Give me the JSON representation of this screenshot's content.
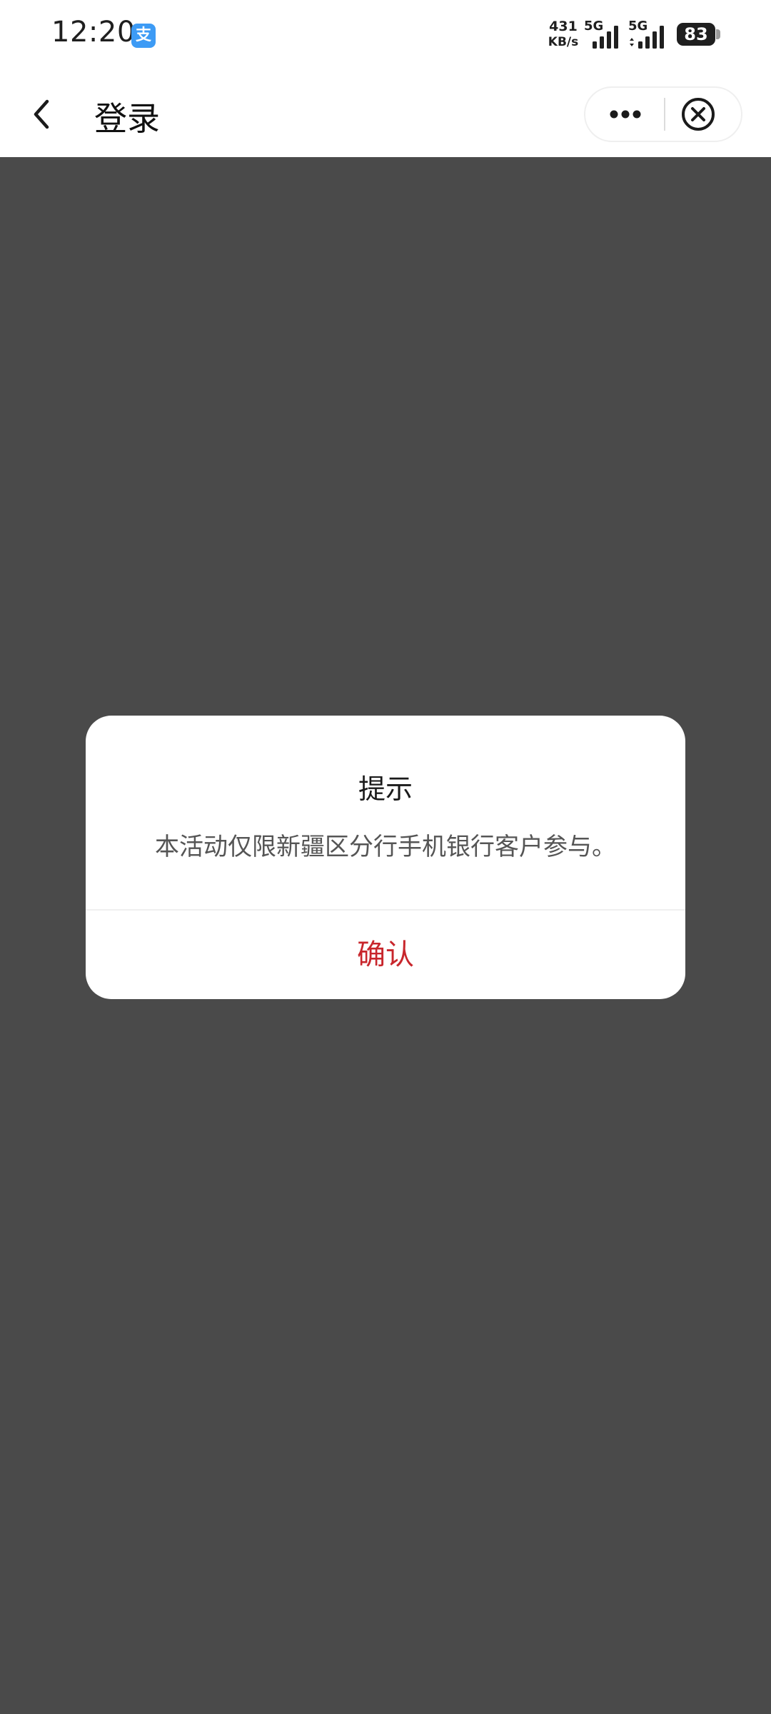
{
  "status_bar": {
    "time": "12:20",
    "app_badge_char": "支",
    "net_speed_value": "431",
    "net_speed_unit": "KB/s",
    "signal_1_label": "5G",
    "signal_2_label": "5G",
    "battery_level": "83",
    "app_badge_color": "#3d9bf5"
  },
  "nav": {
    "title": "登录",
    "back_icon": "chevron-left-icon",
    "more_icon": "more-dots-icon",
    "close_icon": "close-circle-icon"
  },
  "overlay": {
    "background_color": "#4a4a4a"
  },
  "dialog": {
    "title": "提示",
    "message": "本活动仅限新疆区分行手机银行客户参与。",
    "confirm_label": "确认",
    "confirm_color": "#c8262c"
  }
}
